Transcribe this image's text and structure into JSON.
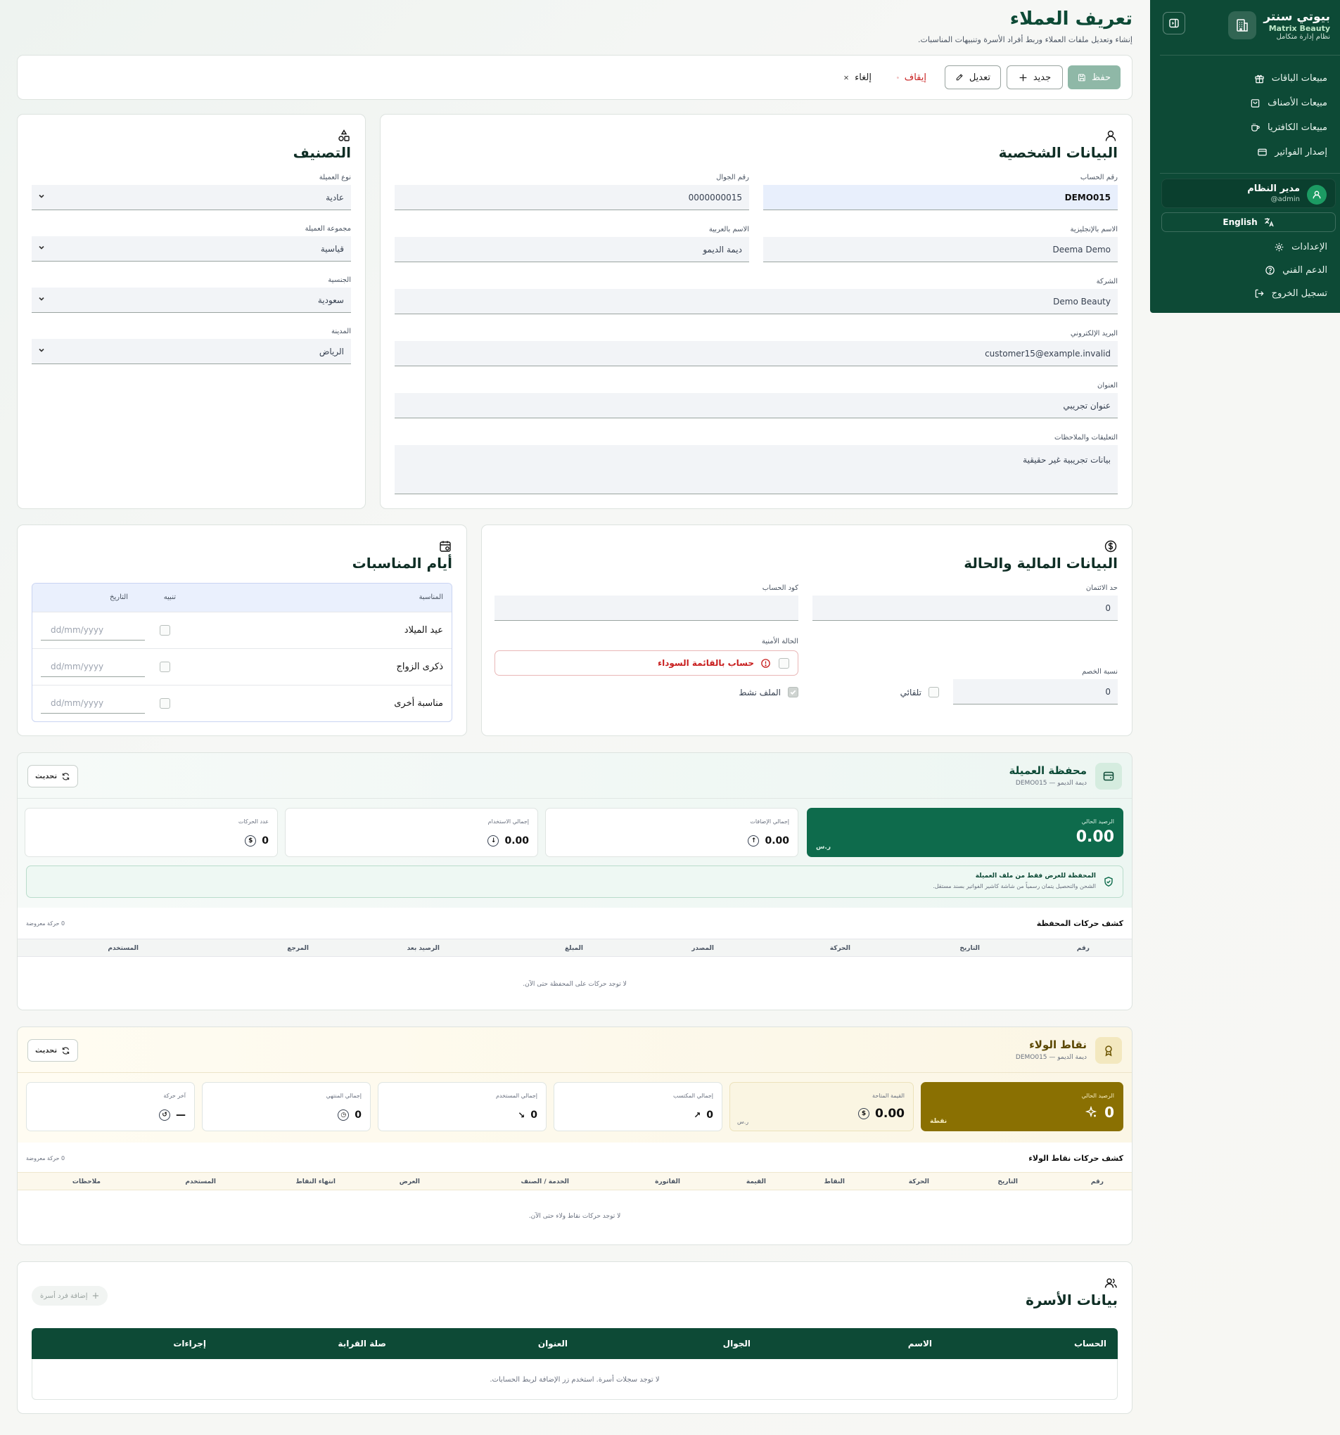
{
  "header": {
    "title": "تعريف العملاء",
    "subtitle": "إنشاء وتعديل ملفات العملاء وربط أفراد الأسرة وتنبيهات المناسبات."
  },
  "sidebar": {
    "brand_title": "بيوتي سنتر",
    "brand_sub": "Matrix Beauty",
    "brand_caption": "نظام إدارة متكامل",
    "items": [
      {
        "label": "مبيعات الباقات",
        "icon": "gift-icon"
      },
      {
        "label": "مبيعات الأصناف",
        "icon": "bag-icon"
      },
      {
        "label": "مبيعات الكافتريا",
        "icon": "coffee-icon"
      },
      {
        "label": "إصدار الفواتير",
        "icon": "card-icon"
      }
    ],
    "user_name": "مدير النظام",
    "user_handle": "@admin",
    "language": "English",
    "bottom": [
      {
        "label": "الإعدادات",
        "icon": "gear-icon"
      },
      {
        "label": "الدعم الفني",
        "icon": "help-icon"
      },
      {
        "label": "تسجيل الخروج",
        "icon": "logout-icon"
      }
    ]
  },
  "toolbar": {
    "save": "حفظ",
    "new": "جديد",
    "edit": "تعديل",
    "stop": "إيقاف",
    "cancel": "إلغاء"
  },
  "personal": {
    "title": "البيانات الشخصية",
    "account_label": "رقم الحساب",
    "account": "DEMO015",
    "mobile_label": "رقم الجوال",
    "mobile": "0000000015",
    "name_en_label": "الاسم بالإنجليزية",
    "name_en": "Deema Demo",
    "name_ar_label": "الاسم بالعربية",
    "name_ar": "ديمة الديمو",
    "company_label": "الشركة",
    "company": "Demo Beauty",
    "email_label": "البريد الإلكتروني",
    "email": "customer15@example.invalid",
    "address_label": "العنوان",
    "address": "عنوان تجريبي",
    "notes_label": "التعليقات والملاحظات",
    "notes": "بيانات تجريبية غير حقيقية"
  },
  "classification": {
    "title": "التصنيف",
    "type_label": "نوع العميلة",
    "type": "عادية",
    "group_label": "مجموعة العميلة",
    "group": "قياسية",
    "nationality_label": "الجنسية",
    "nationality": "سعودية",
    "city_label": "المدينة",
    "city": "الرياض"
  },
  "financial": {
    "title": "البيانات المالية والحالة",
    "credit_label": "حد الائتمان",
    "credit": "0",
    "account_code_label": "كود الحساب",
    "account_code": "",
    "security_label": "الحالة الأمنية",
    "blacklist": "حساب بالقائمة السوداء",
    "discount_label": "نسبة الخصم",
    "discount": "0",
    "auto_label": "تلقائي",
    "active_label": "الملف نشط"
  },
  "occasions": {
    "title": "أيام المناسبات",
    "col_occasion": "المناسبة",
    "col_alert": "تنبيه",
    "col_date": "التاريخ",
    "date_placeholder": "dd/mm/yyyy",
    "rows": [
      {
        "name": "عيد الميلاد"
      },
      {
        "name": "ذكرى الزواج"
      },
      {
        "name": "مناسبة أخرى"
      }
    ]
  },
  "wallet": {
    "title": "محفظة العميلة",
    "subtitle": "ديمة الديمو — DEMO015",
    "refresh": "تحديث",
    "balance_label": "الرصيد الحالي",
    "balance": "0.00",
    "currency": "ر.س",
    "added_label": "إجمالي الإضافات",
    "added": "0.00",
    "used_label": "إجمالي الاستخدام",
    "used": "0.00",
    "moves_label": "عدد الحركات",
    "moves": "0",
    "notice_title": "المحفظة للعرض فقط من ملف العميلة",
    "notice_text": "الشحن والتحصيل يتمان رسمياً من شاشة كاشير الفواتير بسند مستقل.",
    "statement_title": "كشف حركات المحفظة",
    "statement_count": "0 حركة معروضة",
    "columns": [
      "رقم",
      "التاريخ",
      "الحركة",
      "المصدر",
      "المبلغ",
      "الرصيد بعد",
      "المرجع",
      "المستخدم"
    ],
    "empty": "لا توجد حركات على المحفظة حتى الآن."
  },
  "loyalty": {
    "title": "نقاط الولاء",
    "subtitle": "ديمة الديمو — DEMO015",
    "refresh": "تحديث",
    "balance_label": "الرصيد الحالي",
    "balance": "0",
    "points_unit": "نقطة",
    "value_label": "القيمة المتاحة",
    "value": "0.00",
    "currency": "ر.س",
    "earned_label": "إجمالي المكتسب",
    "earned": "0",
    "used_label": "إجمالي المستخدم",
    "used": "0",
    "expired_label": "إجمالي المنتهي",
    "expired": "0",
    "last_label": "آخر حركة",
    "last": "—",
    "statement_title": "كشف حركات نقاط الولاء",
    "statement_count": "0 حركة معروضة",
    "columns": [
      "رقم",
      "التاريخ",
      "الحركة",
      "النقاط",
      "القيمة",
      "الفاتورة",
      "الخدمة / الصنف",
      "العرض",
      "انتهاء النقاط",
      "المستخدم",
      "ملاحظات"
    ],
    "empty": "لا توجد حركات نقاط ولاء حتى الآن."
  },
  "family": {
    "title": "بيانات الأسرة",
    "add": "إضافة فرد أسرة",
    "columns": [
      "الحساب",
      "الاسم",
      "الجوال",
      "العنوان",
      "صلة القرابة",
      "إجراءات"
    ],
    "empty": "لا توجد سجلات أسرة. استخدم زر الإضافة لربط الحسابات."
  }
}
